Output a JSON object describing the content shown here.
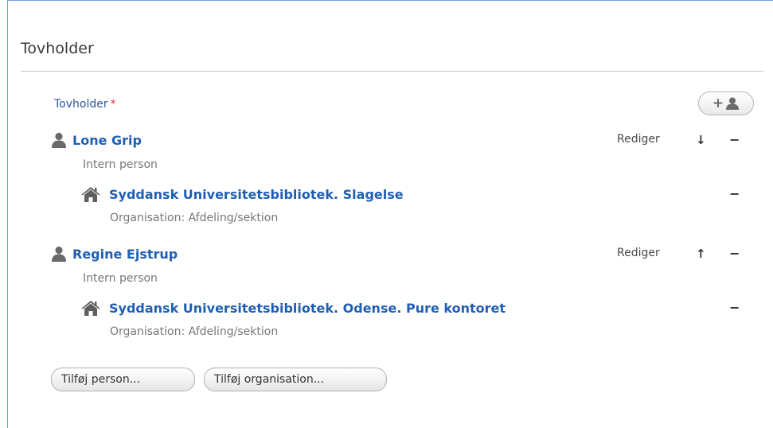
{
  "section": {
    "title": "Tovholder"
  },
  "field": {
    "label": "Tovholder",
    "required_marker": "*"
  },
  "persons": [
    {
      "name": "Lone Grip",
      "type": "Intern person",
      "edit_label": "Rediger",
      "move": "↓",
      "remove": "−",
      "organisation": {
        "name": "Syddansk Universitetsbibliotek. Slagelse",
        "type": "Organisation: Afdeling/sektion",
        "remove": "−"
      }
    },
    {
      "name": "Regine Ejstrup",
      "type": "Intern person",
      "edit_label": "Rediger",
      "move": "↑",
      "remove": "−",
      "organisation": {
        "name": "Syddansk Universitetsbibliotek. Odense. Pure kontoret",
        "type": "Organisation: Afdeling/sektion",
        "remove": "−"
      }
    }
  ],
  "actions": {
    "add_icon": "person-add-icon",
    "add_icon_plus": "+",
    "add_person": "Tilføj person...",
    "add_organisation": "Tilføj organisation..."
  },
  "colors": {
    "link": "#1f5fb3",
    "label": "#2e55a0",
    "required": "#d2373b",
    "frame": "#6f9ad2"
  }
}
